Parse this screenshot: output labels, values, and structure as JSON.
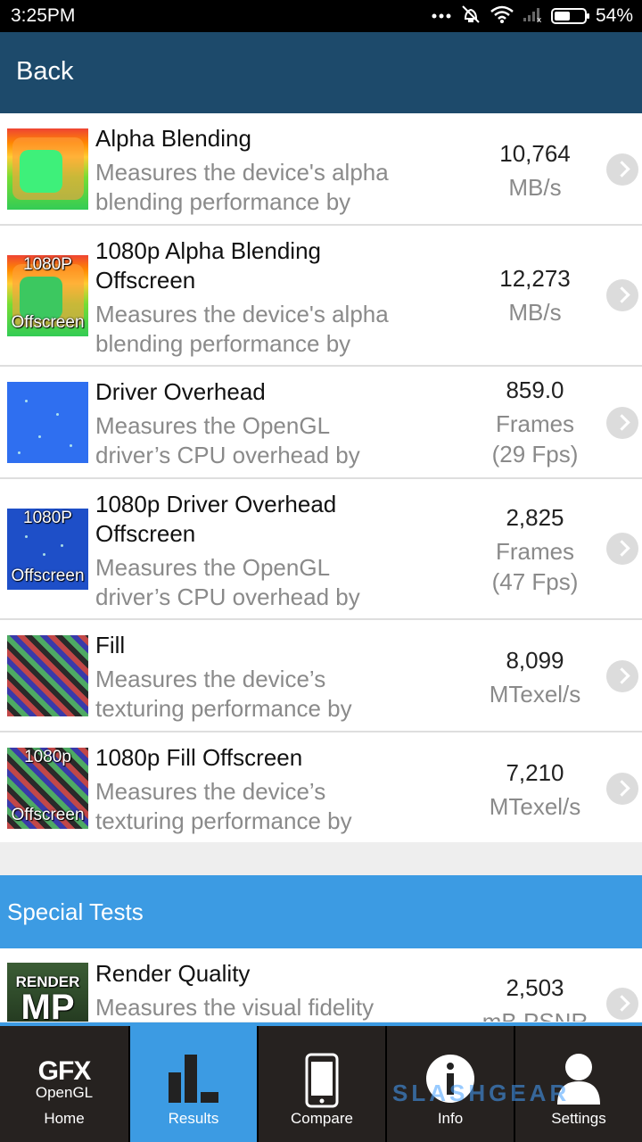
{
  "status_bar": {
    "time": "3:25PM",
    "battery_pct": "54%",
    "battery_level": 0.54
  },
  "header": {
    "back_label": "Back"
  },
  "tests": [
    {
      "title": "Alpha Blending",
      "desc1": "Measures the device's alpha",
      "desc2": "blending performance by",
      "score": "10,764",
      "unit": "MB/s",
      "unit2": "",
      "thumb_label_top": "",
      "thumb_label_bottom": ""
    },
    {
      "title": "1080p Alpha Blending",
      "title2": "Offscreen",
      "desc1": "Measures the device's alpha",
      "desc2": "blending performance by",
      "score": "12,273",
      "unit": "MB/s",
      "unit2": "",
      "thumb_label_top": "1080P",
      "thumb_label_bottom": "Offscreen"
    },
    {
      "title": "Driver Overhead",
      "desc1": "Measures the OpenGL",
      "desc2": "driver’s CPU overhead by",
      "score": "859.0",
      "unit": "Frames",
      "unit2": "(29 Fps)",
      "thumb_label_top": "",
      "thumb_label_bottom": ""
    },
    {
      "title": "1080p Driver Overhead",
      "title2": "Offscreen",
      "desc1": "Measures the OpenGL",
      "desc2": "driver’s CPU overhead by",
      "score": "2,825",
      "unit": "Frames",
      "unit2": "(47 Fps)",
      "thumb_label_top": "1080P",
      "thumb_label_bottom": "Offscreen"
    },
    {
      "title": "Fill",
      "desc1": "Measures the device’s",
      "desc2": "texturing performance by",
      "score": "8,099",
      "unit": "MTexel/s",
      "unit2": "",
      "thumb_label_top": "",
      "thumb_label_bottom": ""
    },
    {
      "title": "1080p Fill Offscreen",
      "desc1": "Measures the device’s",
      "desc2": "texturing performance by",
      "score": "7,210",
      "unit": "MTexel/s",
      "unit2": "",
      "thumb_label_top": "1080p",
      "thumb_label_bottom": "Offscreen"
    }
  ],
  "section": {
    "title": "Special Tests"
  },
  "render_quality": {
    "title": "Render Quality",
    "desc1": "Measures the visual fidelity",
    "score": "2,503",
    "unit": "mB PSNR",
    "thumb_label_top": "RENDER",
    "thumb_label_big": "MP"
  },
  "tabs": [
    {
      "label": "Home",
      "logo_big": "GFX",
      "logo_small": "OpenGL"
    },
    {
      "label": "Results"
    },
    {
      "label": "Compare"
    },
    {
      "label": "Info"
    },
    {
      "label": "Settings"
    }
  ],
  "watermark": "SLASHGEAR",
  "colors": {
    "header": "#1d4a6b",
    "accent": "#3c9be3",
    "tab_bg": "#262220"
  }
}
